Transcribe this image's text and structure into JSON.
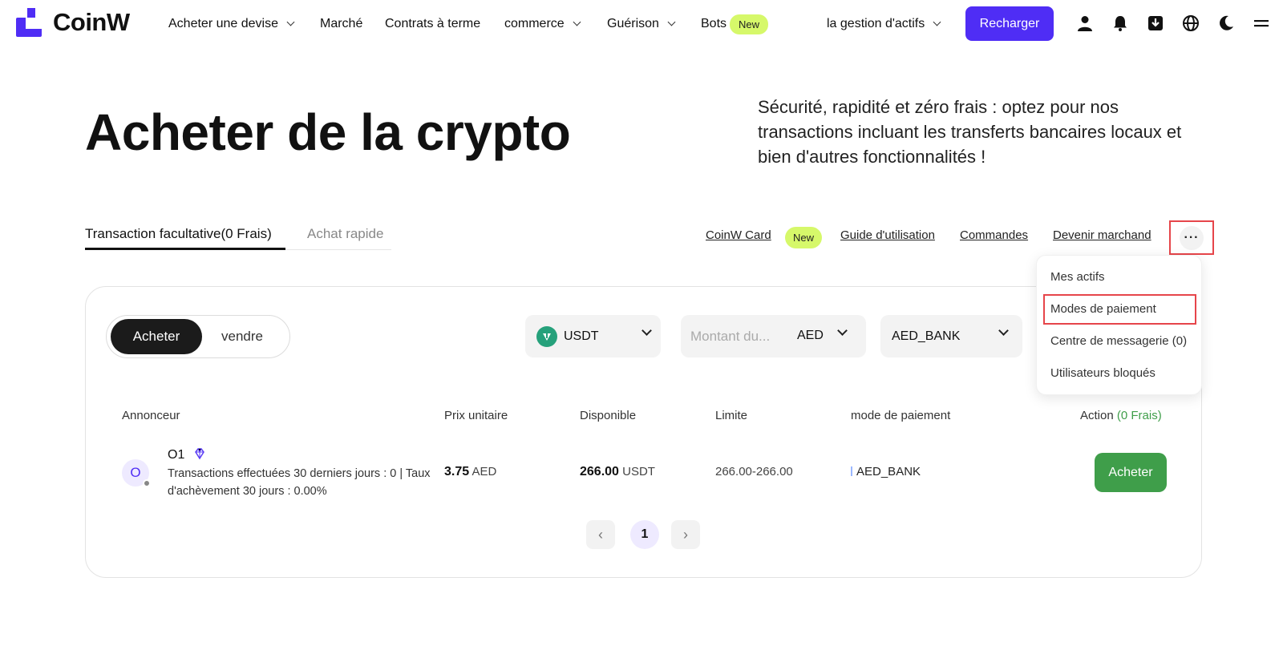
{
  "header": {
    "logo_text": "CoinW",
    "nav": {
      "buy_currency": "Acheter une devise",
      "market": "Marché",
      "futures": "Contrats à terme",
      "commerce": "commerce",
      "guerison": "Guérison",
      "bots": "Bots",
      "bots_badge": "New",
      "asset_management": "la gestion d'actifs"
    },
    "recharge_label": "Recharger",
    "icons": [
      "user-icon",
      "bell-icon",
      "download-icon",
      "globe-icon",
      "moon-icon",
      "menu-icon"
    ]
  },
  "hero": {
    "title": "Acheter de la crypto",
    "subtitle": "Sécurité, rapidité et zéro frais : optez pour nos transactions incluant les transferts bancaires locaux et bien d'autres fonctionnalités !"
  },
  "tabs": {
    "optional": "Transaction facultative(0 Frais)",
    "quick": "Achat rapide"
  },
  "top_links": {
    "card": "CoinW Card",
    "card_badge": "New",
    "guide": "Guide d'utilisation",
    "orders": "Commandes",
    "merchant": "Devenir marchand",
    "more": "···"
  },
  "more_menu": {
    "items": [
      "Mes actifs",
      "Modes de paiement",
      "Centre de messagerie (0)",
      "Utilisateurs bloqués"
    ]
  },
  "trade": {
    "buy_label": "Acheter",
    "sell_label": "vendre",
    "coin": "USDT",
    "amount_placeholder": "Montant du...",
    "fiat": "AED",
    "payment": "AED_BANK"
  },
  "table": {
    "headers": {
      "advertiser": "Annonceur",
      "unit_price": "Prix unitaire",
      "available": "Disponible",
      "limit": "Limite",
      "payment_method": "mode de paiement",
      "action": "Action",
      "action_note": "(0 Frais)"
    },
    "rows": [
      {
        "avatar": "O",
        "name": "O1",
        "stats": "Transactions effectuées 30 derniers jours : 0 | Taux d'achèvement 30 jours : 0.00%",
        "price": "3.75",
        "price_currency": "AED",
        "available": "266.00",
        "available_currency": "USDT",
        "limit": "266.00-266.00",
        "payment": "AED_BANK",
        "action": "Acheter"
      }
    ]
  },
  "pagination": {
    "prev": "‹",
    "current": "1",
    "next": "›"
  }
}
